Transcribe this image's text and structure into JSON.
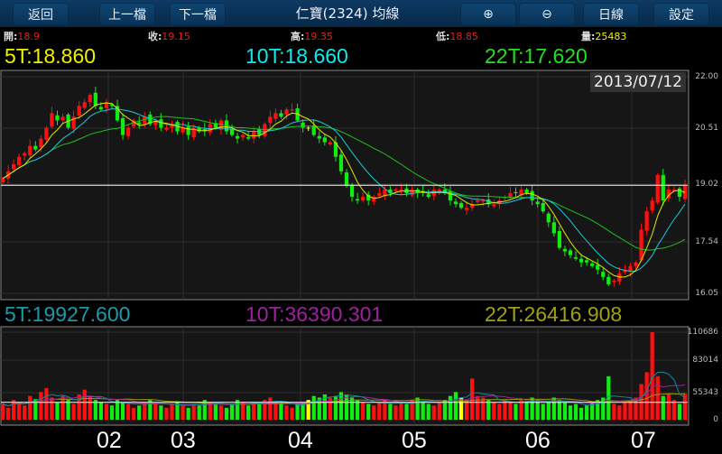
{
  "toolbar": {
    "back": "返回",
    "prev": "上一檔",
    "next": "下一檔",
    "title": "仁寶(2324) 均線",
    "zoom_in_icon": "zoom-in-icon",
    "zoom_out_icon": "zoom-out-icon",
    "period": "日線",
    "settings": "設定"
  },
  "quote": {
    "open_label": "開:",
    "open": "18.9",
    "close_label": "收:",
    "close": "19.15",
    "high_label": "高:",
    "high": "19.35",
    "low_label": "低:",
    "low": "18.85",
    "vol_label": "量:",
    "vol": "25483"
  },
  "price_ma": {
    "ma5": "5T:18.860",
    "ma10": "10T:18.660",
    "ma22": "22T:17.620"
  },
  "vol_ma": {
    "ma5": "5T:19927.600",
    "ma10": "10T:36390.301",
    "ma22": "22T:26416.908"
  },
  "cursor_date": "2013/07/12",
  "price_axis": [
    "22.00",
    "20.51",
    "19.02",
    "17.54",
    "16.05"
  ],
  "vol_axis": [
    "110686",
    "83014",
    "55343",
    "0"
  ],
  "months": [
    "02",
    "03",
    "04",
    "05",
    "06",
    "07"
  ],
  "colors": {
    "up": "#ff1010",
    "down": "#10ee10",
    "flat": "#ffff00",
    "ma5": "#e6e600",
    "ma10": "#20c8d8",
    "ma22": "#20c020",
    "vma5": "#138a9a",
    "vma10": "#a020a0",
    "vma22": "#9a9a10"
  },
  "chart_data": {
    "type": "candlestick",
    "price_range": [
      16.05,
      22.0
    ],
    "vol_range": [
      0,
      110686
    ],
    "cursor_price": 19.02,
    "cursor_vol": 22000,
    "closes": [
      19.2,
      19.4,
      19.6,
      19.8,
      19.9,
      20.1,
      20.0,
      20.3,
      20.6,
      21.0,
      20.8,
      20.9,
      20.6,
      20.9,
      21.2,
      21.3,
      21.5,
      21.2,
      21.1,
      21.3,
      21.2,
      20.8,
      20.4,
      20.6,
      20.8,
      20.7,
      20.9,
      20.7,
      20.8,
      20.6,
      20.6,
      20.7,
      20.5,
      20.6,
      20.4,
      20.6,
      20.5,
      20.5,
      20.7,
      20.6,
      20.8,
      20.5,
      20.4,
      20.3,
      20.4,
      20.3,
      20.5,
      20.4,
      20.7,
      20.9,
      21.0,
      20.9,
      21.1,
      21.1,
      20.8,
      20.6,
      20.6,
      20.4,
      20.3,
      20.2,
      20.2,
      19.8,
      19.4,
      19.0,
      18.7,
      18.6,
      18.7,
      18.6,
      18.7,
      18.8,
      18.9,
      18.8,
      18.9,
      18.9,
      18.8,
      18.9,
      18.8,
      18.8,
      18.7,
      18.9,
      18.9,
      18.8,
      18.6,
      18.5,
      18.4,
      18.4,
      18.5,
      18.6,
      18.6,
      18.5,
      18.5,
      18.6,
      18.7,
      18.8,
      18.8,
      18.9,
      18.8,
      18.6,
      18.5,
      18.3,
      18.0,
      17.7,
      17.3,
      17.2,
      17.1,
      17.0,
      16.9,
      16.9,
      16.8,
      16.7,
      16.5,
      16.3,
      16.4,
      16.6,
      16.7,
      16.8,
      16.9,
      17.8,
      18.3,
      18.6,
      19.3,
      18.6,
      18.9,
      18.9,
      18.7,
      19.0
    ],
    "volumes": [
      20000,
      15000,
      25000,
      22000,
      18000,
      30000,
      26000,
      35000,
      40000,
      28000,
      22000,
      30000,
      25000,
      20000,
      32000,
      38000,
      30000,
      25000,
      22000,
      20000,
      18000,
      25000,
      22000,
      20000,
      15000,
      18000,
      22000,
      25000,
      20000,
      18000,
      15000,
      20000,
      22000,
      18000,
      15000,
      20000,
      18000,
      25000,
      22000,
      20000,
      18000,
      15000,
      20000,
      25000,
      22000,
      18000,
      20000,
      22000,
      25000,
      28000,
      22000,
      20000,
      18000,
      15000,
      20000,
      22000,
      25000,
      30000,
      28000,
      32000,
      28000,
      30000,
      35000,
      32000,
      28000,
      25000,
      22000,
      20000,
      18000,
      22000,
      25000,
      20000,
      18000,
      22000,
      20000,
      25000,
      28000,
      22000,
      20000,
      18000,
      22000,
      25000,
      30000,
      35000,
      28000,
      25000,
      52000,
      30000,
      28000,
      25000,
      22000,
      20000,
      25000,
      22000,
      20000,
      25000,
      22000,
      28000,
      25000,
      20000,
      22000,
      28000,
      25000,
      22000,
      18000,
      20000,
      15000,
      18000,
      22000,
      25000,
      28000,
      55000,
      20000,
      18000,
      22000,
      25000,
      28000,
      45000,
      60000,
      110686,
      55000,
      30000,
      32000,
      25000,
      20000,
      33000
    ]
  }
}
